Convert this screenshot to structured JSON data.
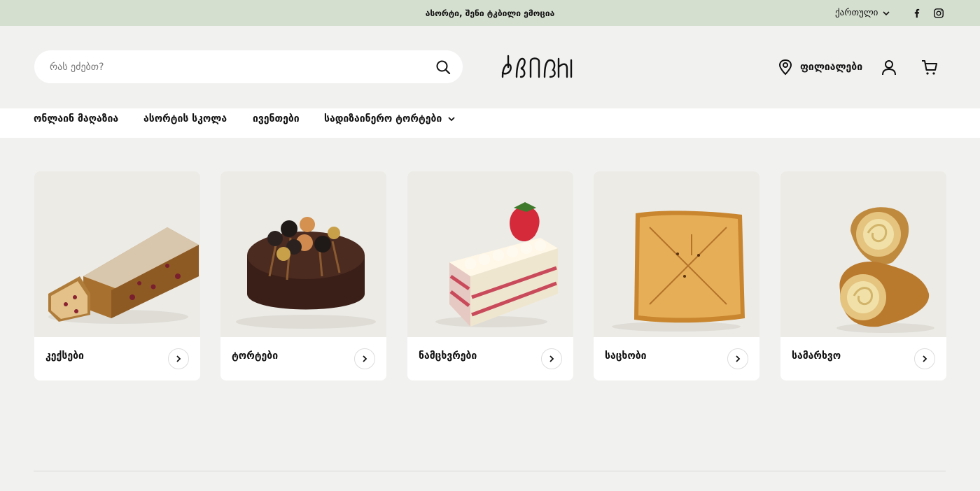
{
  "announcement": "ასორტი, შენი ტკბილი ემოცია",
  "language": {
    "label": "ქართული",
    "icon": "chevron-down-icon"
  },
  "social": [
    {
      "name": "facebook-icon"
    },
    {
      "name": "instagram-icon"
    }
  ],
  "search": {
    "placeholder": "რას ეძებთ?",
    "value": ""
  },
  "logo": {
    "text": "ასორტი"
  },
  "header": {
    "branches_label": "ფილიალები"
  },
  "nav": {
    "items": [
      {
        "label": "ონლაინ მაღაზია"
      },
      {
        "label": "ასორტის სკოლა"
      },
      {
        "label": "ივენთები"
      },
      {
        "label": "სადიზაინერო ტორტები",
        "has_dropdown": true
      }
    ]
  },
  "categories": [
    {
      "label": "კექსები"
    },
    {
      "label": "ტორტები"
    },
    {
      "label": "ნამცხვრები"
    },
    {
      "label": "საცხობი"
    },
    {
      "label": "სამარხვო"
    }
  ],
  "colors": {
    "topbar": "#d5dfd0",
    "page_bg": "#f1f1f0",
    "card_img_bg": "#ecebe6"
  }
}
